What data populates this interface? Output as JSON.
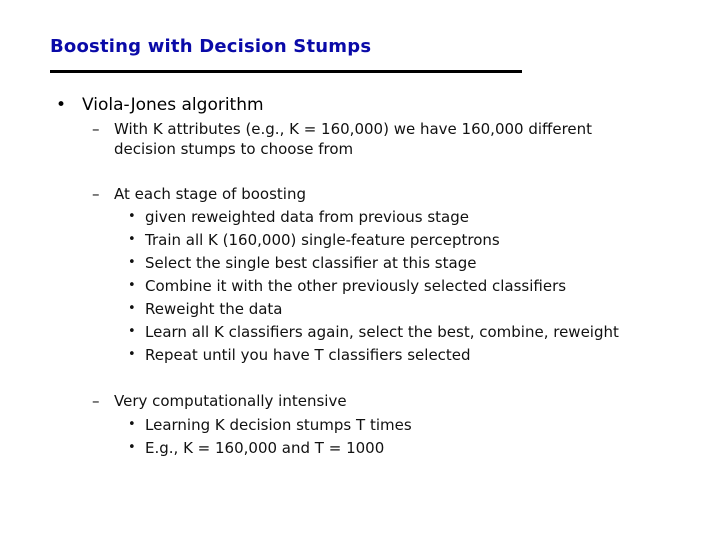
{
  "slide": {
    "title": "Boosting with Decision Stumps",
    "bullet_glyph": "•",
    "dash_glyph": "–",
    "main_bullet": "Viola-Jones algorithm",
    "sections": [
      {
        "lines": [
          "With K attributes (e.g., K = 160,000) we have 160,000 different",
          "decision stumps to choose from"
        ],
        "items": []
      },
      {
        "lines": [
          "At each stage of boosting"
        ],
        "items": [
          "given reweighted data from previous stage",
          "Train all K (160,000) single-feature perceptrons",
          "Select the single best classifier at this stage",
          "Combine it with the other previously selected classifiers",
          "Reweight the data",
          "Learn all K classifiers again, select the best, combine, reweight",
          "Repeat until you have T classifiers selected"
        ]
      },
      {
        "lines": [
          "Very computationally intensive"
        ],
        "items": [
          "Learning K decision stumps T times",
          "E.g., K = 160,000 and T = 1000"
        ]
      }
    ]
  }
}
